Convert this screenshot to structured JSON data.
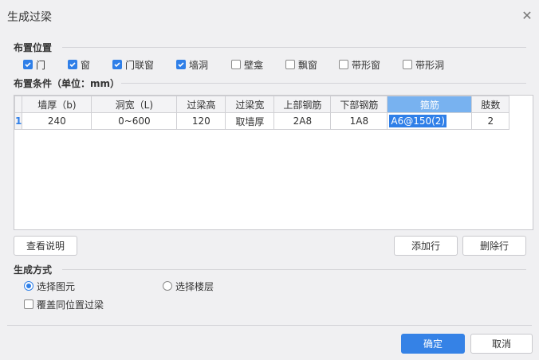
{
  "window": {
    "title": "生成过梁"
  },
  "placement": {
    "heading": "布置位置",
    "checkboxes": [
      {
        "label": "门",
        "checked": true
      },
      {
        "label": "窗",
        "checked": true
      },
      {
        "label": "门联窗",
        "checked": true
      },
      {
        "label": "墙洞",
        "checked": true
      },
      {
        "label": "壁龛",
        "checked": false
      },
      {
        "label": "飘窗",
        "checked": false
      },
      {
        "label": "带形窗",
        "checked": false
      },
      {
        "label": "带形洞",
        "checked": false
      }
    ]
  },
  "conditions": {
    "heading": "布置条件（单位：mm）",
    "columns": [
      "墙厚（b)",
      "洞宽（L)",
      "过梁高",
      "过梁宽",
      "上部钢筋",
      "下部钢筋",
      "箍筋",
      "肢数"
    ],
    "active_column": "箍筋",
    "rows": [
      {
        "num": "1",
        "cells": [
          "240",
          "0~600",
          "120",
          "取墙厚",
          "2A8",
          "1A8",
          "A6@150(2)",
          "2"
        ]
      }
    ]
  },
  "buttons": {
    "view_help": "查看说明",
    "add_row": "添加行",
    "delete_row": "删除行",
    "ok": "确定",
    "cancel": "取消"
  },
  "generate": {
    "heading": "生成方式",
    "options": [
      {
        "label": "选择图元",
        "selected": true
      },
      {
        "label": "选择楼层",
        "selected": false
      }
    ],
    "overwrite": {
      "label": "覆盖同位置过梁",
      "checked": false
    }
  },
  "colors": {
    "accent": "#2f7fe8",
    "primary_button": "#3582e6",
    "active_header": "#78b2f0"
  }
}
